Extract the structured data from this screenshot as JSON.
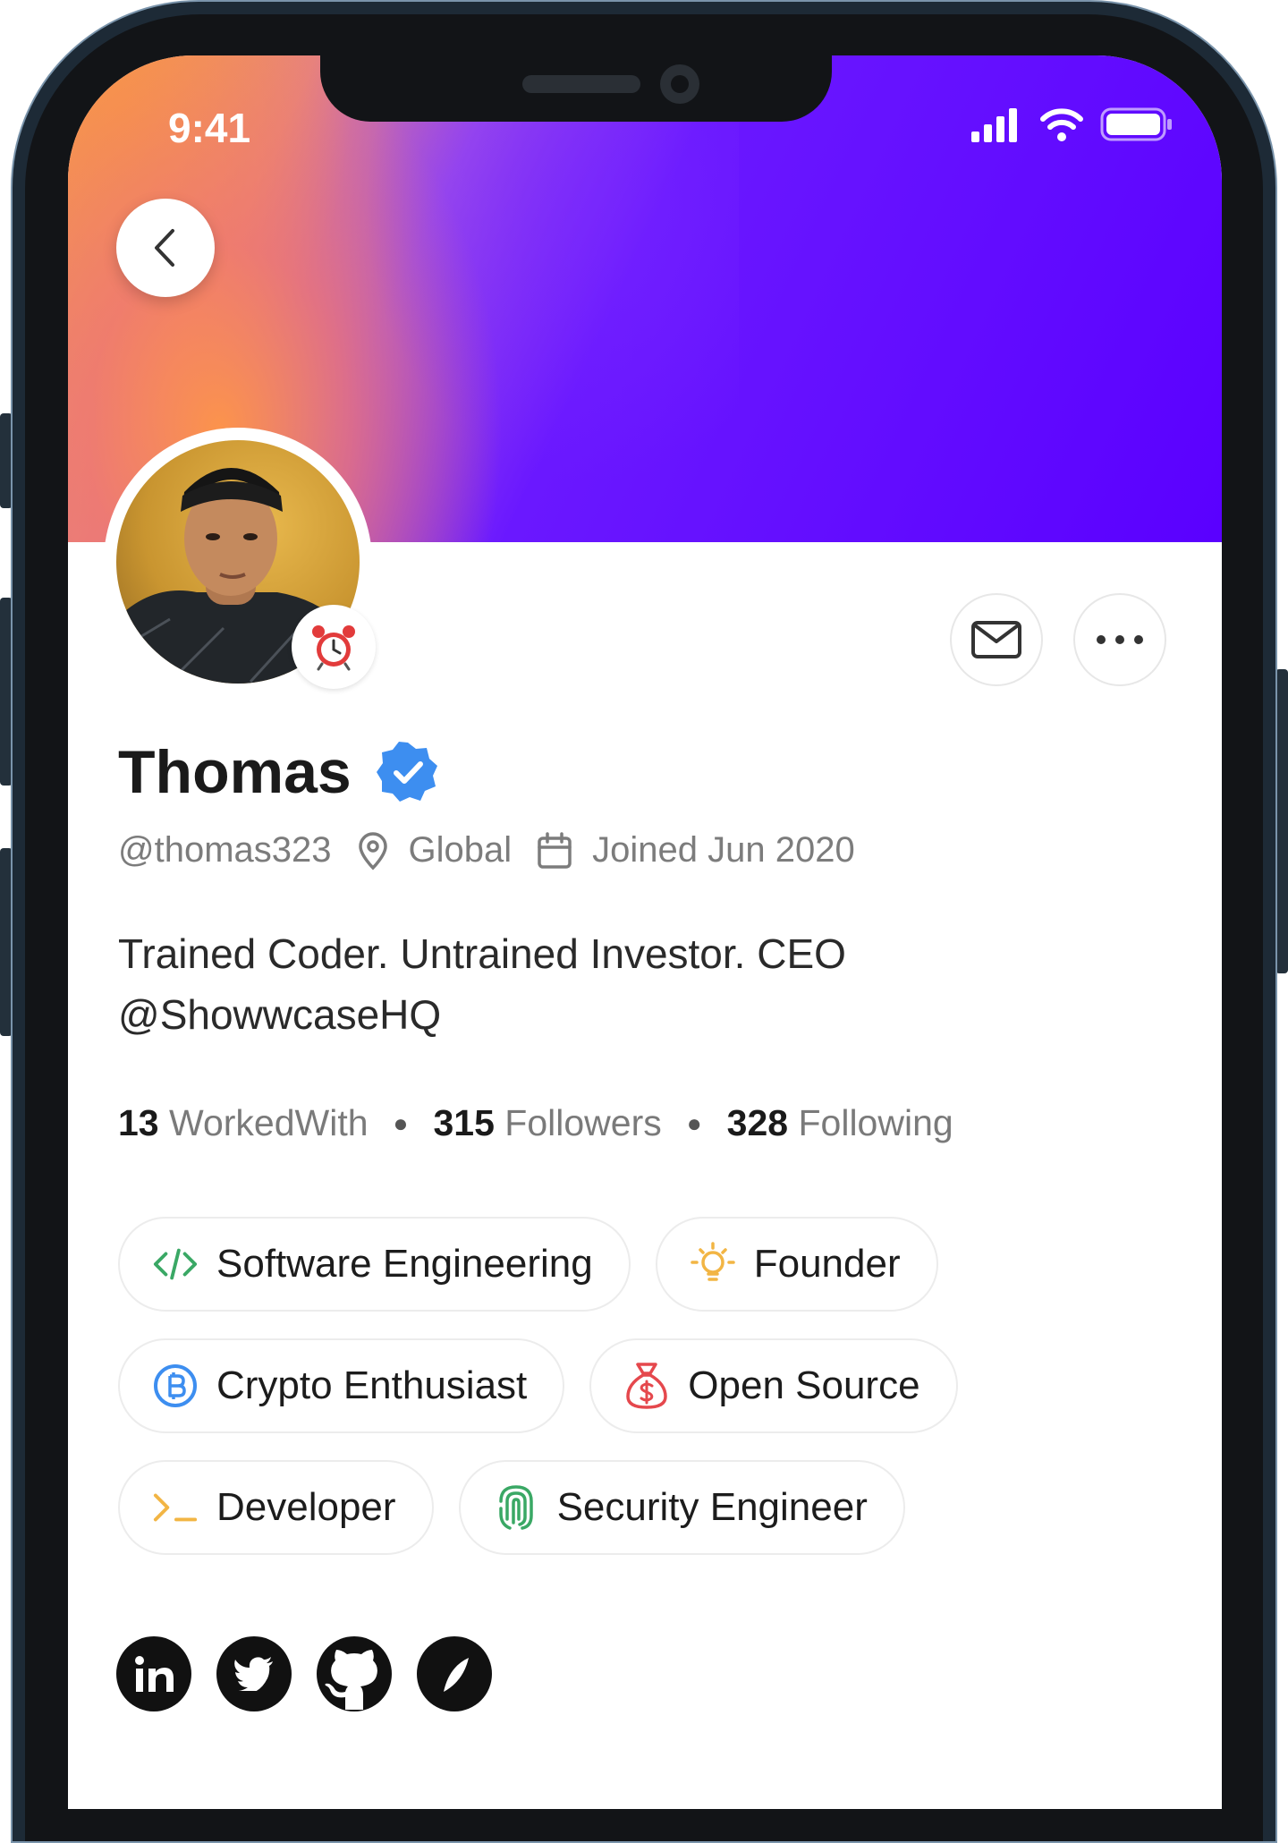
{
  "status_bar": {
    "time": "9:41"
  },
  "profile": {
    "name": "Thomas",
    "handle": "@thomas323",
    "location": "Global",
    "joined": "Joined Jun 2020",
    "bio_line1": "Trained Coder. Untrained Investor. CEO",
    "bio_line2": "@ShowwcaseHQ"
  },
  "stats": [
    {
      "count": "13",
      "label": "WorkedWith"
    },
    {
      "count": "315",
      "label": "Followers"
    },
    {
      "count": "328",
      "label": "Following"
    }
  ],
  "tags": [
    {
      "label": "Software Engineering",
      "icon": "code-icon",
      "color": "#3aa865"
    },
    {
      "label": "Founder",
      "icon": "lightbulb-icon",
      "color": "#f2b544"
    },
    {
      "label": "Crypto Enthusiast",
      "icon": "bitcoin-icon",
      "color": "#3d8ef0"
    },
    {
      "label": "Open Source",
      "icon": "money-bag-icon",
      "color": "#e5484d"
    },
    {
      "label": "Developer",
      "icon": "terminal-icon",
      "color": "#f2b544"
    },
    {
      "label": "Security Engineer",
      "icon": "fingerprint-icon",
      "color": "#3aa865"
    }
  ],
  "socials": [
    "linkedin-icon",
    "twitter-icon",
    "github-icon",
    "hashnode-icon"
  ],
  "colors": {
    "accent": "#5a00ff",
    "verified": "#3d8ef0",
    "banner_warm": "#f39a4e"
  }
}
